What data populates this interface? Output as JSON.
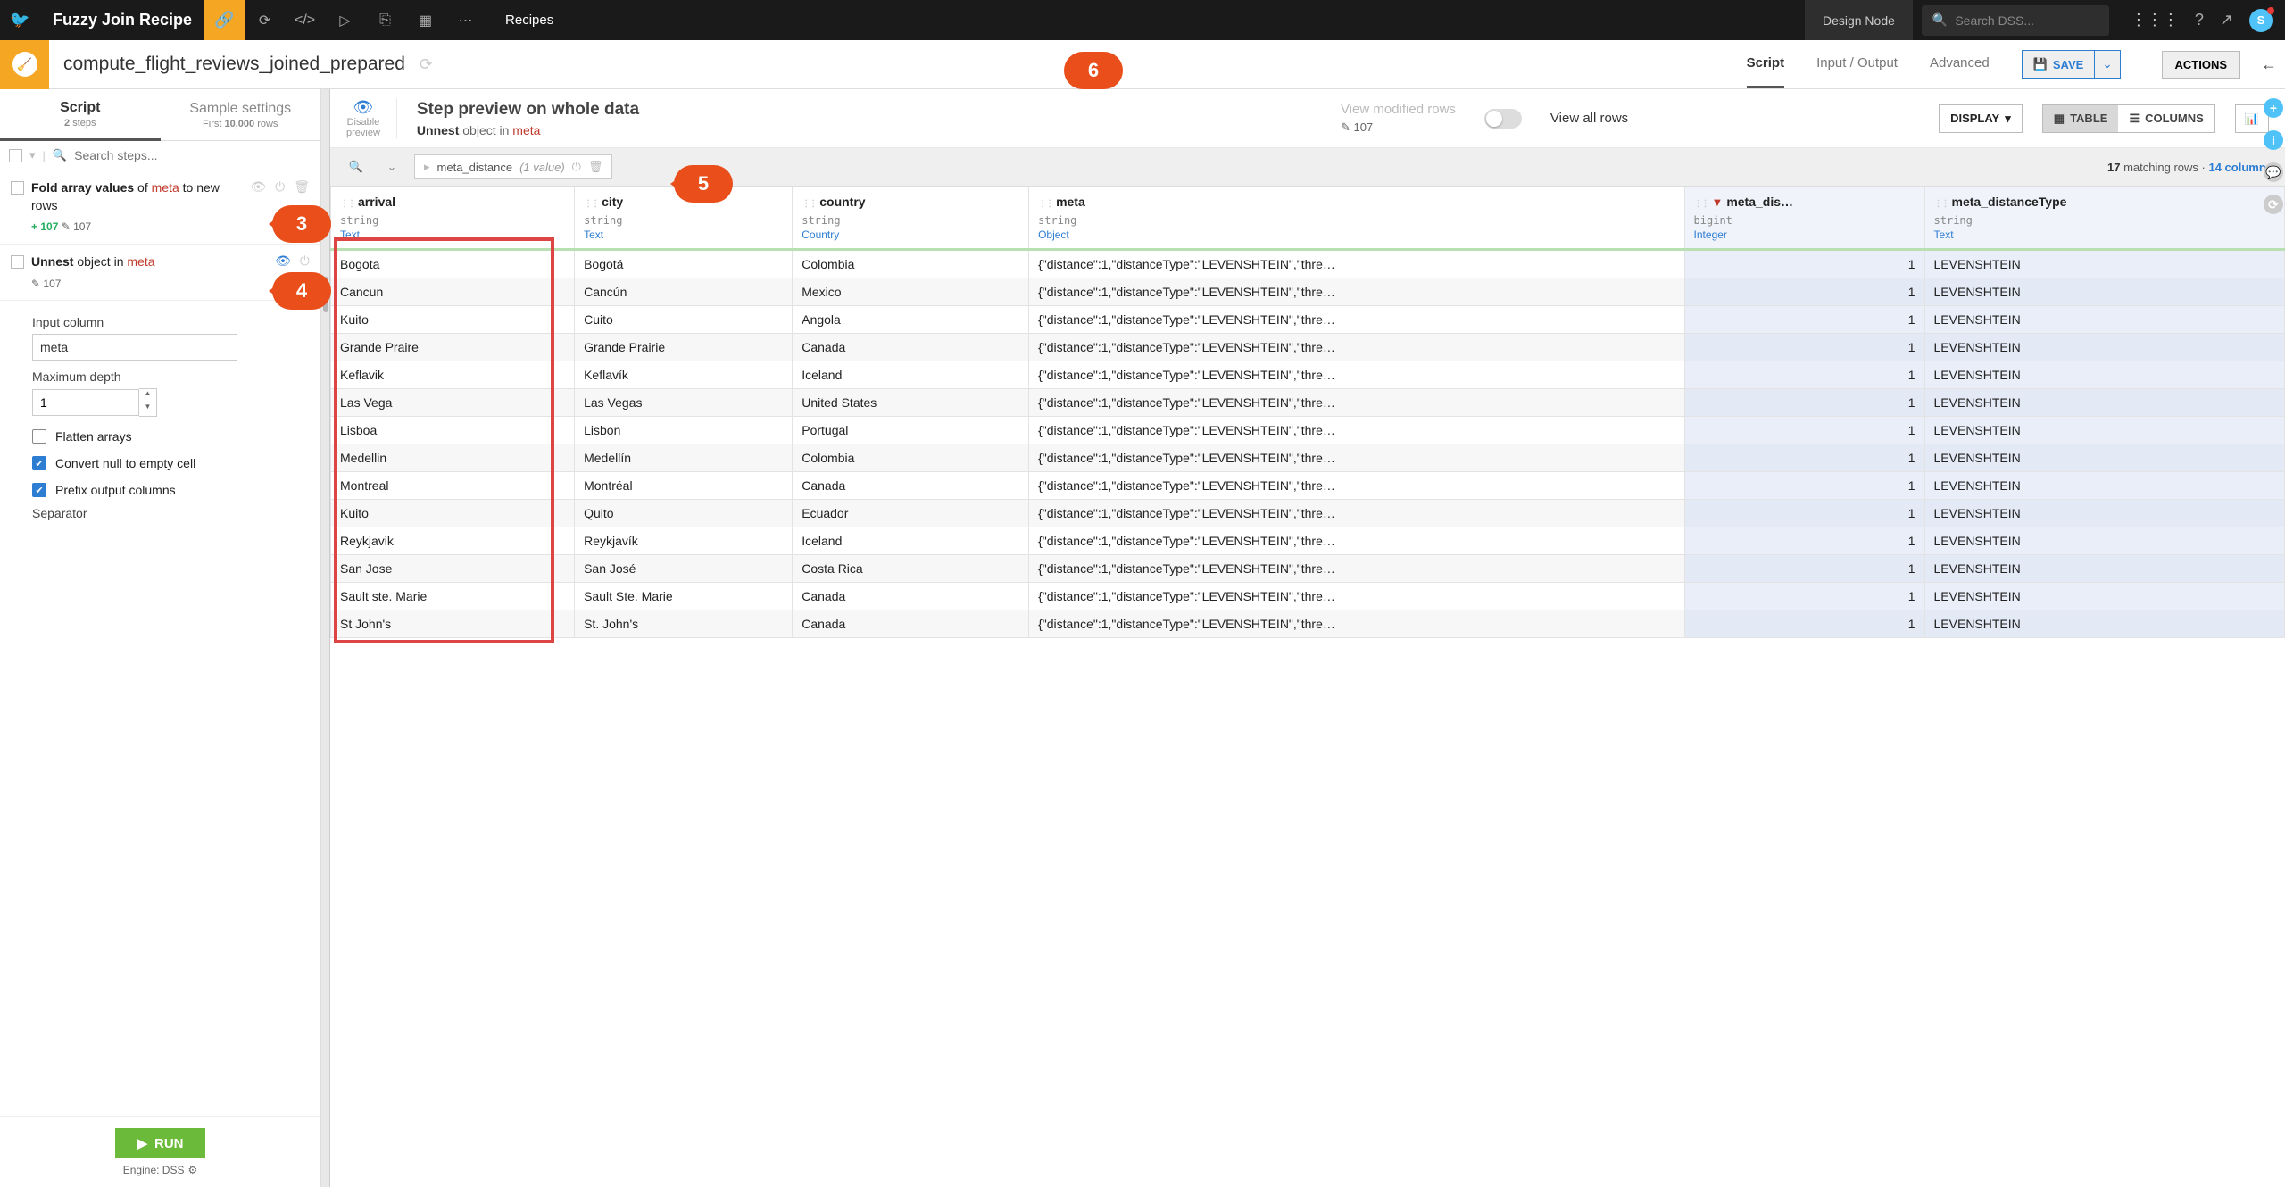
{
  "topbar": {
    "title": "Fuzzy Join Recipe",
    "recipes_tab": "Recipes",
    "design_node": "Design Node",
    "search_placeholder": "Search DSS...",
    "avatar_letter": "S"
  },
  "subbar": {
    "recipe_name": "compute_flight_reviews_joined_prepared",
    "tabs": {
      "script": "Script",
      "io": "Input / Output",
      "advanced": "Advanced"
    },
    "save_label": "SAVE",
    "actions_label": "ACTIONS"
  },
  "left": {
    "tab_script": "Script",
    "tab_script_sub_count": "2",
    "tab_script_sub_word": "steps",
    "tab_sample": "Sample settings",
    "tab_sample_sub_prefix": "First ",
    "tab_sample_sub_count": "10,000",
    "tab_sample_sub_word": " rows",
    "search_placeholder": "Search steps...",
    "step1": {
      "prefix": "Fold array values",
      "of": " of ",
      "meta": "meta",
      "suffix": " to new rows",
      "plus": "+ 107",
      "edit": "✎ 107"
    },
    "step2": {
      "prefix": "Unnest",
      "mid": " object in ",
      "meta": "meta",
      "edit": "✎ 107",
      "form": {
        "input_column_label": "Input column",
        "input_column_value": "meta",
        "max_depth_label": "Maximum depth",
        "max_depth_value": "1",
        "flatten_label": "Flatten arrays",
        "convert_null_label": "Convert null to empty cell",
        "prefix_output_label": "Prefix output columns",
        "separator_label": "Separator"
      }
    },
    "run_label": "RUN",
    "engine_label": "Engine: DSS"
  },
  "header": {
    "disable_preview_top": "Disable",
    "disable_preview_bottom": "preview",
    "step_title": "Step preview on whole data",
    "step_sub_a": "Unnest",
    "step_sub_b": " object in ",
    "step_sub_meta": "meta",
    "view_mod": "View modified rows",
    "view_mod_sub": "✎ 107",
    "view_all": "View all rows",
    "display_label": "DISPLAY",
    "table_label": "TABLE",
    "columns_label": "COLUMNS"
  },
  "filter": {
    "chip_name": "meta_distance",
    "chip_val": "(1 value)",
    "matching_rows_count": "17",
    "matching_rows_word": " matching rows",
    "columns_count": "14 columns"
  },
  "columns": {
    "arrival": {
      "name": "arrival",
      "type": "string",
      "meaning": "Text"
    },
    "city": {
      "name": "city",
      "type": "string",
      "meaning": "Text"
    },
    "country": {
      "name": "country",
      "type": "string",
      "meaning": "Country"
    },
    "meta": {
      "name": "meta",
      "type": "string",
      "meaning": "Object"
    },
    "meta_dist": {
      "name": "meta_dis…",
      "type": "bigint",
      "meaning": "Integer"
    },
    "meta_dtype": {
      "name": "meta_distanceType",
      "type": "string",
      "meaning": "Text"
    }
  },
  "chart_data": {
    "type": "table",
    "columns": [
      "arrival",
      "city",
      "country",
      "meta",
      "meta_distance",
      "meta_distanceType"
    ],
    "rows": [
      {
        "arrival": "Bogota",
        "city": "Bogotá",
        "country": "Colombia",
        "meta": "{\"distance\":1,\"distanceType\":\"LEVENSHTEIN\",\"thre…",
        "meta_distance": 1,
        "meta_distanceType": "LEVENSHTEIN"
      },
      {
        "arrival": "Cancun",
        "city": "Cancún",
        "country": "Mexico",
        "meta": "{\"distance\":1,\"distanceType\":\"LEVENSHTEIN\",\"thre…",
        "meta_distance": 1,
        "meta_distanceType": "LEVENSHTEIN"
      },
      {
        "arrival": "Kuito",
        "city": "Cuito",
        "country": "Angola",
        "meta": "{\"distance\":1,\"distanceType\":\"LEVENSHTEIN\",\"thre…",
        "meta_distance": 1,
        "meta_distanceType": "LEVENSHTEIN"
      },
      {
        "arrival": "Grande Praire",
        "city": "Grande Prairie",
        "country": "Canada",
        "meta": "{\"distance\":1,\"distanceType\":\"LEVENSHTEIN\",\"thre…",
        "meta_distance": 1,
        "meta_distanceType": "LEVENSHTEIN"
      },
      {
        "arrival": "Keflavik",
        "city": "Keflavík",
        "country": "Iceland",
        "meta": "{\"distance\":1,\"distanceType\":\"LEVENSHTEIN\",\"thre…",
        "meta_distance": 1,
        "meta_distanceType": "LEVENSHTEIN"
      },
      {
        "arrival": "Las Vega",
        "city": "Las Vegas",
        "country": "United States",
        "meta": "{\"distance\":1,\"distanceType\":\"LEVENSHTEIN\",\"thre…",
        "meta_distance": 1,
        "meta_distanceType": "LEVENSHTEIN"
      },
      {
        "arrival": "Lisboa",
        "city": "Lisbon",
        "country": "Portugal",
        "meta": "{\"distance\":1,\"distanceType\":\"LEVENSHTEIN\",\"thre…",
        "meta_distance": 1,
        "meta_distanceType": "LEVENSHTEIN"
      },
      {
        "arrival": "Medellin",
        "city": "Medellín",
        "country": "Colombia",
        "meta": "{\"distance\":1,\"distanceType\":\"LEVENSHTEIN\",\"thre…",
        "meta_distance": 1,
        "meta_distanceType": "LEVENSHTEIN"
      },
      {
        "arrival": "Montreal",
        "city": "Montréal",
        "country": "Canada",
        "meta": "{\"distance\":1,\"distanceType\":\"LEVENSHTEIN\",\"thre…",
        "meta_distance": 1,
        "meta_distanceType": "LEVENSHTEIN"
      },
      {
        "arrival": "Kuito",
        "city": "Quito",
        "country": "Ecuador",
        "meta": "{\"distance\":1,\"distanceType\":\"LEVENSHTEIN\",\"thre…",
        "meta_distance": 1,
        "meta_distanceType": "LEVENSHTEIN"
      },
      {
        "arrival": "Reykjavik",
        "city": "Reykjavík",
        "country": "Iceland",
        "meta": "{\"distance\":1,\"distanceType\":\"LEVENSHTEIN\",\"thre…",
        "meta_distance": 1,
        "meta_distanceType": "LEVENSHTEIN"
      },
      {
        "arrival": "San Jose",
        "city": "San José",
        "country": "Costa Rica",
        "meta": "{\"distance\":1,\"distanceType\":\"LEVENSHTEIN\",\"thre…",
        "meta_distance": 1,
        "meta_distanceType": "LEVENSHTEIN"
      },
      {
        "arrival": "Sault ste. Marie",
        "city": "Sault Ste. Marie",
        "country": "Canada",
        "meta": "{\"distance\":1,\"distanceType\":\"LEVENSHTEIN\",\"thre…",
        "meta_distance": 1,
        "meta_distanceType": "LEVENSHTEIN"
      },
      {
        "arrival": "St John's",
        "city": "St. John's",
        "country": "Canada",
        "meta": "{\"distance\":1,\"distanceType\":\"LEVENSHTEIN\",\"thre…",
        "meta_distance": 1,
        "meta_distanceType": "LEVENSHTEIN"
      }
    ]
  },
  "callouts": {
    "c3": "3",
    "c4": "4",
    "c5": "5",
    "c6": "6"
  }
}
